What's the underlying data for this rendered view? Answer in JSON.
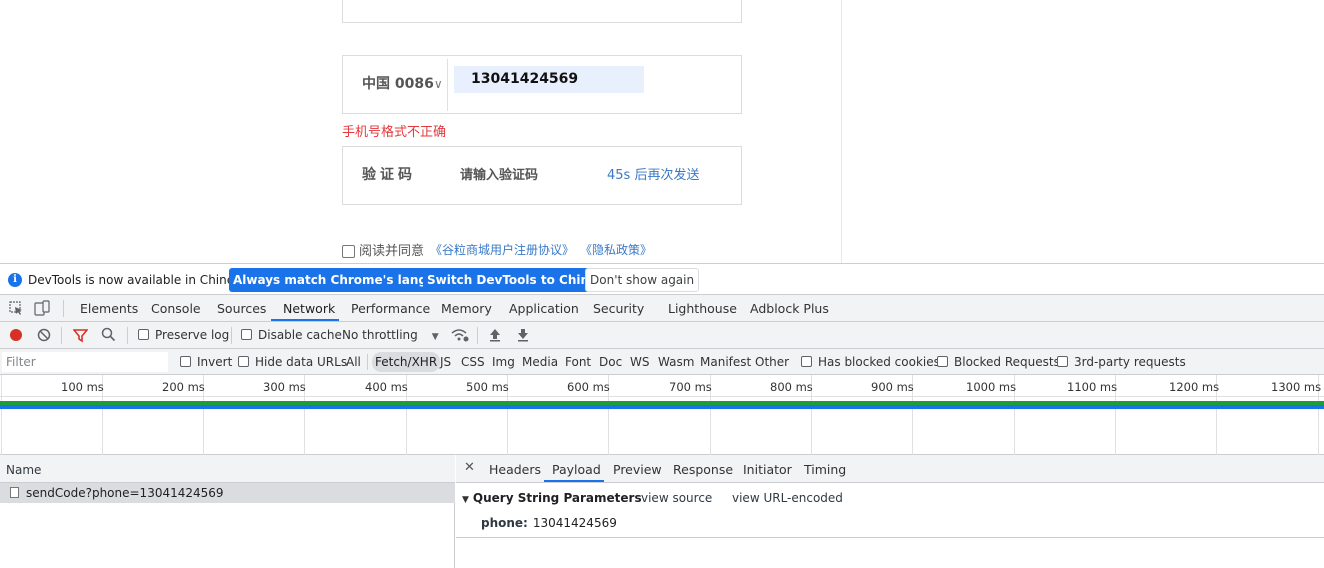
{
  "form": {
    "phone_country": "中国 0086",
    "phone_value": "13041424569",
    "phone_error": "手机号格式不正确",
    "code_label": "验证码",
    "code_placeholder": "请输入验证码",
    "resend_text": "45s 后再次发送",
    "agree_text": "阅读并同意",
    "agreement_link": "《谷粒商城用户注册协议》",
    "privacy_link": "《隐私政策》"
  },
  "devtools": {
    "infobar": {
      "message": "DevTools is now available in Chinese!",
      "btn_match": "Always match Chrome's language",
      "btn_switch": "Switch DevTools to Chinese",
      "btn_dismiss": "Don't show again"
    },
    "tabs": [
      "Elements",
      "Console",
      "Sources",
      "Network",
      "Performance",
      "Memory",
      "Application",
      "Security",
      "Lighthouse",
      "Adblock Plus"
    ],
    "active_tab": "Network",
    "toolbar": {
      "preserve_log": "Preserve log",
      "disable_cache": "Disable cache",
      "throttling": "No throttling"
    },
    "filter": {
      "placeholder": "Filter",
      "invert": "Invert",
      "hide_data_urls": "Hide data URLs",
      "types": [
        "All",
        "Fetch/XHR",
        "JS",
        "CSS",
        "Img",
        "Media",
        "Font",
        "Doc",
        "WS",
        "Wasm",
        "Manifest",
        "Other"
      ],
      "active_type": "Fetch/XHR",
      "blocked_cookies": "Has blocked cookies",
      "blocked_requests": "Blocked Requests",
      "third_party": "3rd-party requests"
    },
    "timeline_ticks": [
      "100 ms",
      "200 ms",
      "300 ms",
      "400 ms",
      "500 ms",
      "600 ms",
      "700 ms",
      "800 ms",
      "900 ms",
      "1000 ms",
      "1100 ms",
      "1200 ms",
      "1300 ms"
    ],
    "requests": {
      "column_name": "Name",
      "rows": [
        "sendCode?phone=13041424569"
      ]
    },
    "detail": {
      "tabs": [
        "Headers",
        "Payload",
        "Preview",
        "Response",
        "Initiator",
        "Timing"
      ],
      "active_tab": "Payload",
      "section_title": "Query String Parameters",
      "view_source": "view source",
      "view_url_encoded": "view URL-encoded",
      "param_key": "phone:",
      "param_value": "13041424569"
    }
  }
}
